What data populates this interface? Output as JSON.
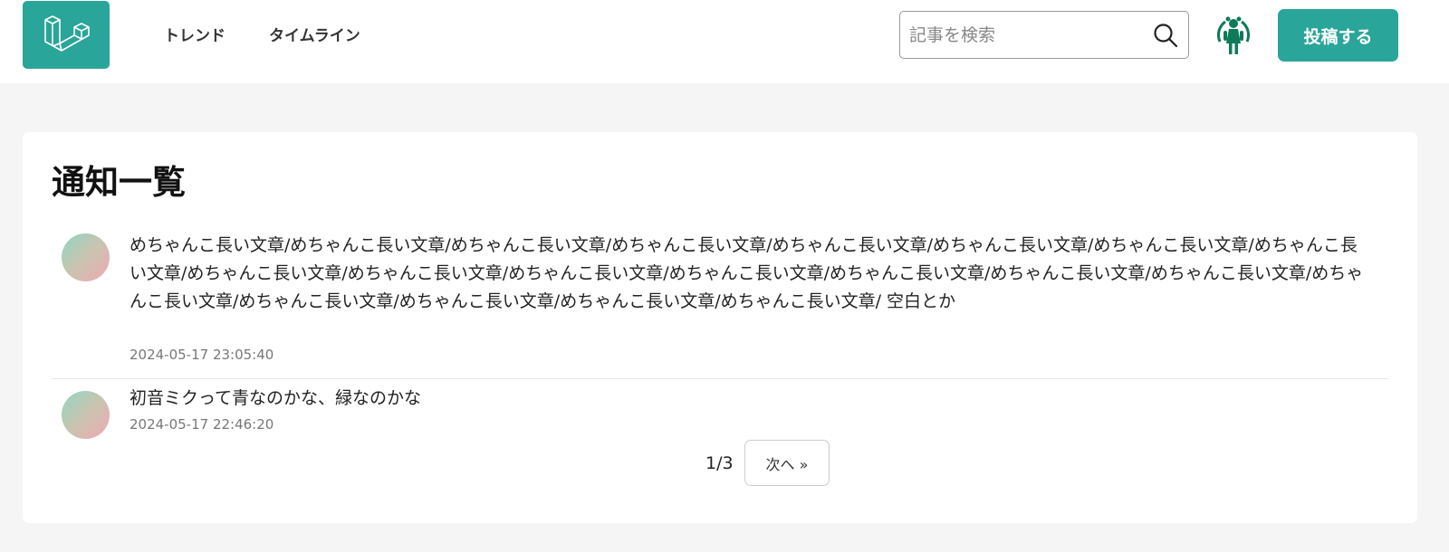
{
  "colors": {
    "brand": "#2aa59a",
    "background": "#f5f5f5",
    "avatar_icon": "#0f7a5a"
  },
  "header": {
    "logo_icon": "laravel-logo-icon",
    "nav": [
      {
        "label": "トレンド"
      },
      {
        "label": "タイムライン"
      }
    ],
    "search": {
      "placeholder": "記事を検索",
      "value": "",
      "icon": "search-icon"
    },
    "user_avatar_icon": "user-avatar-icon",
    "post_label": "投稿する"
  },
  "main": {
    "title": "通知一覧",
    "notifications": [
      {
        "text": "めちゃんこ長い文章/めちゃんこ長い文章/めちゃんこ長い文章/めちゃんこ長い文章/めちゃんこ長い文章/めちゃんこ長い文章/めちゃんこ長い文章/めちゃんこ長い文章/めちゃんこ長い文章/めちゃんこ長い文章/めちゃんこ長い文章/めちゃんこ長い文章/めちゃんこ長い文章/めちゃんこ長い文章/めちゃんこ長い文章/めちゃんこ長い文章/めちゃんこ長い文章/めちゃんこ長い文章/めちゃんこ長い文章/めちゃんこ長い文章/ 空白とか",
        "date": "2024-05-17 23:05:40"
      },
      {
        "text": "初音ミクって青なのかな、緑なのかな",
        "date": "2024-05-17 22:46:20"
      }
    ],
    "pagination": {
      "indicator": "1/3",
      "next_label": "次へ »"
    }
  }
}
